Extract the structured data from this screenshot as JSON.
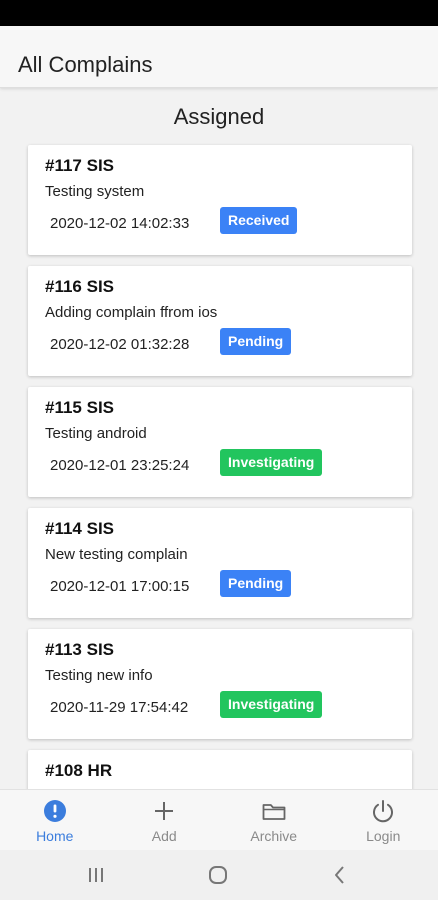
{
  "header": {
    "title": "All Complains"
  },
  "section": {
    "title": "Assigned"
  },
  "complaints": [
    {
      "title": "#117 SIS",
      "description": "Testing system",
      "date": "2020-12-02 14:02:33",
      "status": "Received",
      "status_color": "#3b82f6"
    },
    {
      "title": "#116 SIS",
      "description": "Adding complain ffrom ios",
      "date": "2020-12-02 01:32:28",
      "status": "Pending",
      "status_color": "#3b82f6"
    },
    {
      "title": "#115 SIS",
      "description": "Testing android",
      "date": "2020-12-01 23:25:24",
      "status": "Investigating",
      "status_color": "#22c55e"
    },
    {
      "title": "#114 SIS",
      "description": "New testing complain",
      "date": "2020-12-01 17:00:15",
      "status": "Pending",
      "status_color": "#3b82f6"
    },
    {
      "title": "#113 SIS",
      "description": "Testing new info",
      "date": "2020-11-29 17:54:42",
      "status": "Investigating",
      "status_color": "#22c55e"
    },
    {
      "title": "#108 HR",
      "description": "",
      "date": "",
      "status": "",
      "status_color": "#3b82f6"
    }
  ],
  "nav": {
    "items": [
      {
        "label": "Home",
        "icon": "alert-circle-icon",
        "active": true
      },
      {
        "label": "Add",
        "icon": "plus-icon",
        "active": false
      },
      {
        "label": "Archive",
        "icon": "folder-icon",
        "active": false
      },
      {
        "label": "Login",
        "icon": "power-icon",
        "active": false
      }
    ]
  },
  "colors": {
    "accent": "#3b7ddd",
    "blue_badge": "#3b82f6",
    "green_badge": "#22c55e"
  }
}
